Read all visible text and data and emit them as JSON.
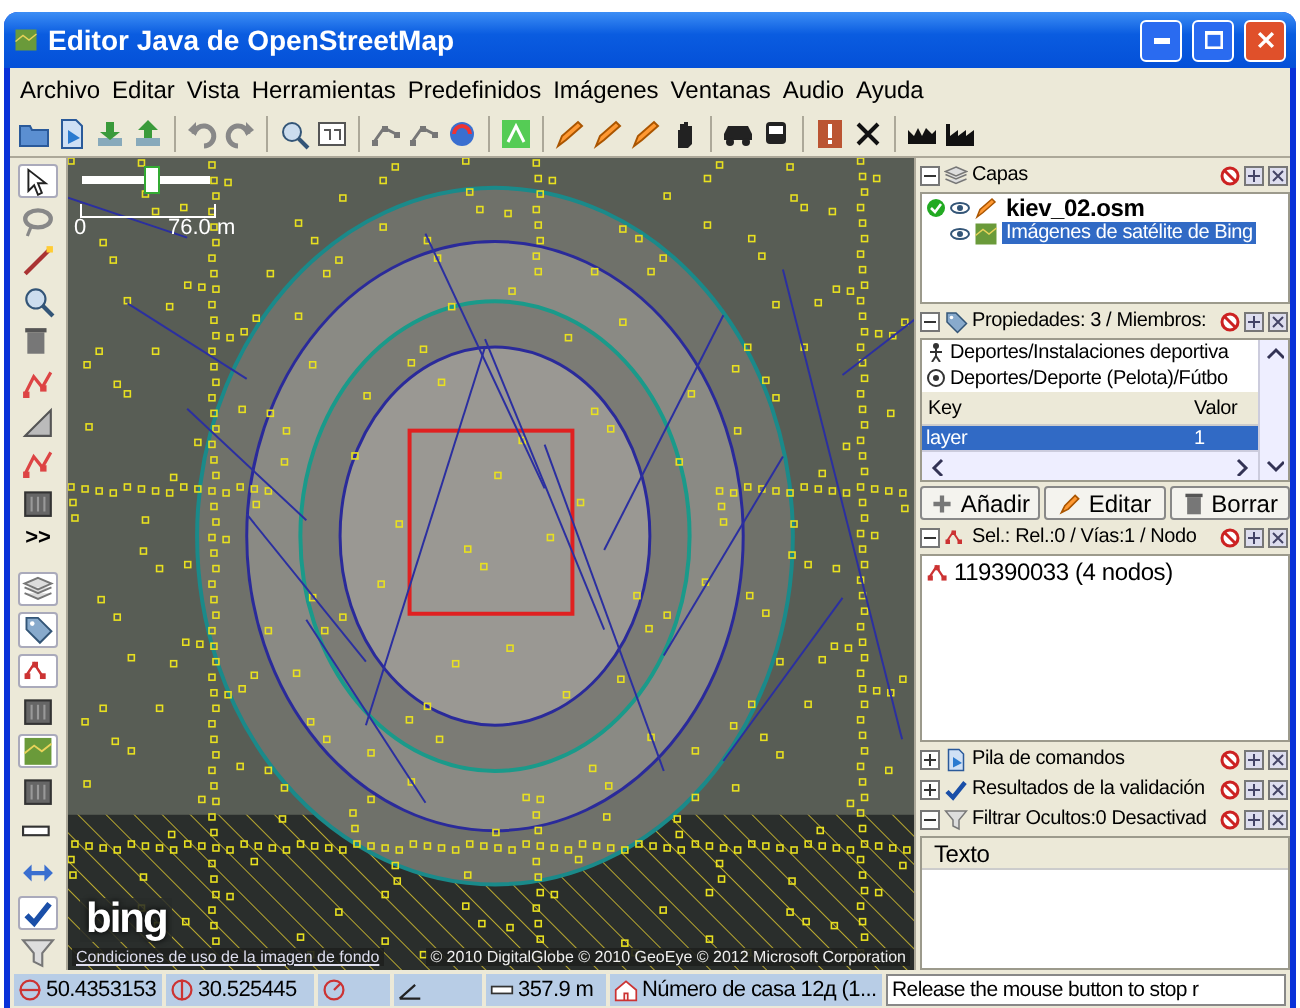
{
  "window": {
    "title": "Editor Java de OpenStreetMap"
  },
  "menu": [
    "Archivo",
    "Editar",
    "Vista",
    "Herramientas",
    "Predefinidos",
    "Imágenes",
    "Ventanas",
    "Audio",
    "Ayuda"
  ],
  "left_toolbar": {
    "more": ">>"
  },
  "map": {
    "scale_start": "0",
    "scale_end": "76.0 m",
    "zoom_slider": {
      "level": 0.55
    },
    "logo": "bing",
    "terms_link": "Condiciones de uso de la imagen de fondo",
    "attribution": "© 2010 DigitalGlobe © 2010 GeoEye © 2012 Microsoft Corporation"
  },
  "layers": {
    "title": "Capas",
    "items": [
      {
        "name": "kiev_02.osm",
        "active": true,
        "selected": false
      },
      {
        "name": "Imágenes de satélite de Bing",
        "active": false,
        "selected": true
      }
    ]
  },
  "properties": {
    "title": "Propiedades: 3 / Miembros:",
    "presets": [
      "Deportes/Instalaciones deportiva",
      "Deportes/Deporte (Pelota)/Fútbo"
    ],
    "columns": [
      "Key",
      "Valor"
    ],
    "rows": [
      {
        "key": "layer",
        "value": "1",
        "selected": true
      }
    ],
    "buttons": [
      "Añadir",
      "Editar",
      "Borrar"
    ]
  },
  "selection": {
    "title": "Sel.: Rel.:0 / Vías:1 / Nodo",
    "items": [
      "119390033 (4 nodos)"
    ]
  },
  "collapsed_panels": [
    "Pila de comandos",
    "Resultados de la validación"
  ],
  "filter": {
    "title": "Filtrar Ocultos:0 Desactivad",
    "columns": [
      "Texto"
    ]
  },
  "status_bar": [
    {
      "kind": "lat",
      "text": "50.4353153"
    },
    {
      "kind": "lon",
      "text": "30.525445"
    },
    {
      "kind": "heading"
    },
    {
      "kind": "angle"
    },
    {
      "kind": "distance",
      "text": "357.9 m"
    },
    {
      "kind": "name",
      "text": "Número de casa 12д (1..."
    },
    {
      "kind": "help",
      "text": "Release the mouse button to stop r"
    }
  ]
}
